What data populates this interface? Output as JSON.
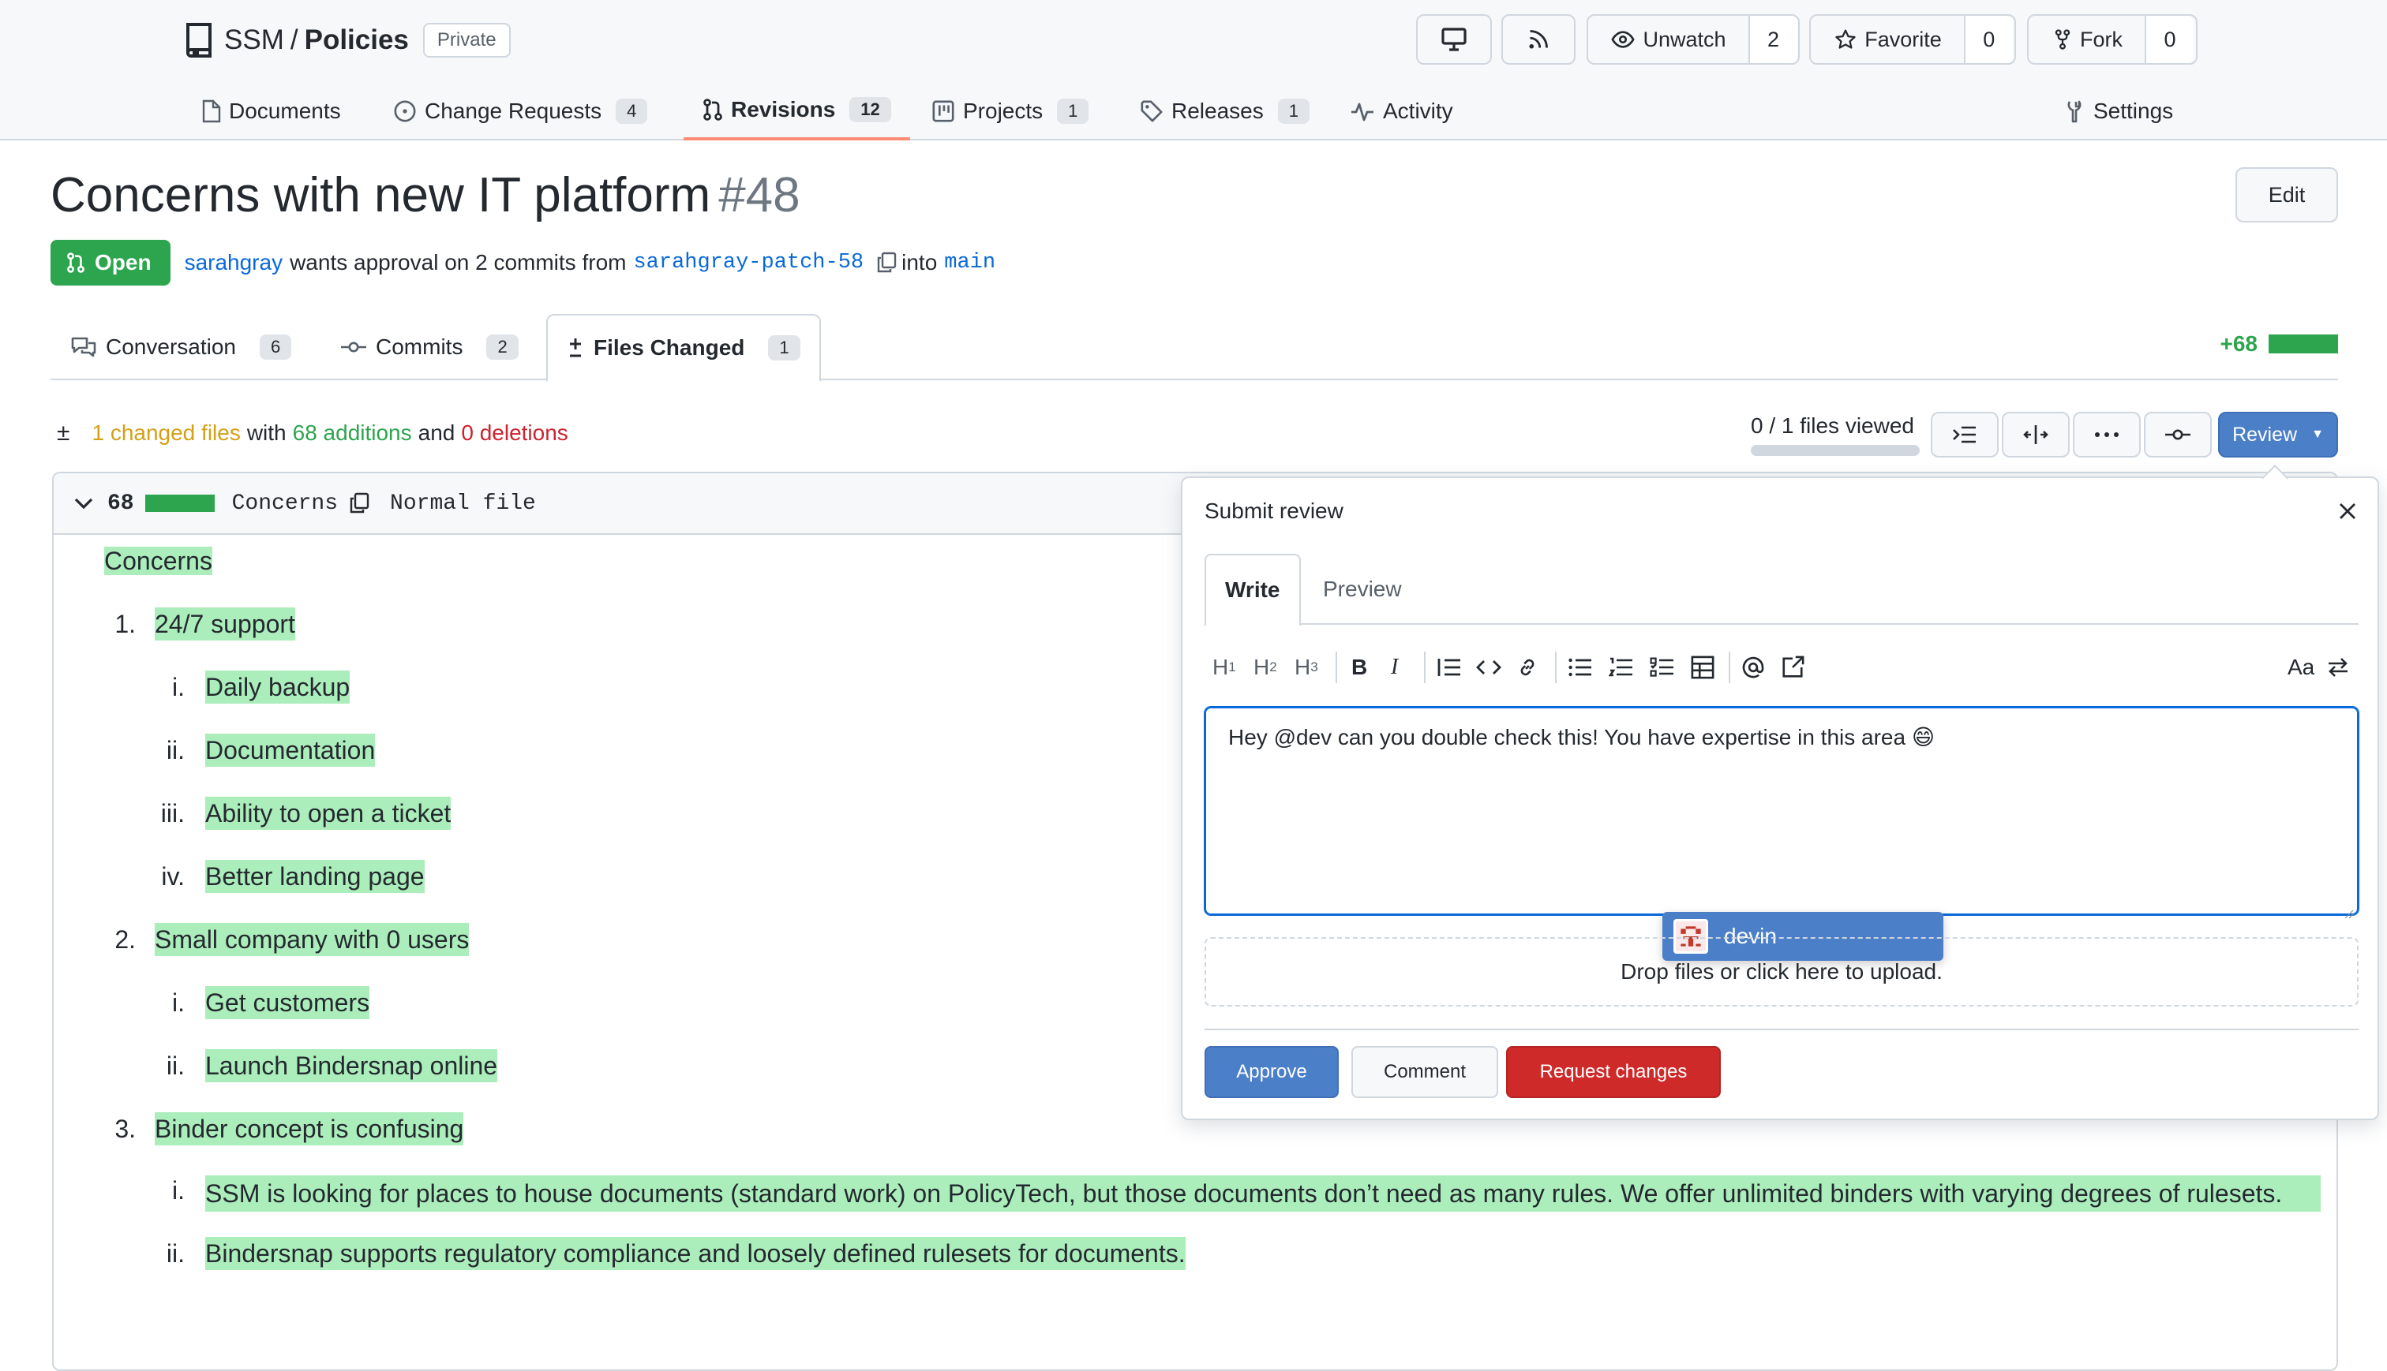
{
  "repo": {
    "owner": "SSM",
    "separator": "/",
    "name": "Policies",
    "visibility": "Private"
  },
  "header_actions": {
    "unwatch_label": "Unwatch",
    "unwatch_count": "2",
    "favorite_label": "Favorite",
    "favorite_count": "0",
    "fork_label": "Fork",
    "fork_count": "0"
  },
  "repo_nav": [
    {
      "label": "Documents",
      "count": ""
    },
    {
      "label": "Change Requests",
      "count": "4"
    },
    {
      "label": "Revisions",
      "count": "12",
      "active": true
    },
    {
      "label": "Projects",
      "count": "1"
    },
    {
      "label": "Releases",
      "count": "1"
    },
    {
      "label": "Activity",
      "count": ""
    },
    {
      "label": "Settings",
      "count": ""
    }
  ],
  "pr": {
    "title": "Concerns with new IT platform",
    "number": "#48",
    "edit_label": "Edit",
    "status": "Open",
    "author": "sarahgray",
    "meta_text": "wants approval on 2 commits from",
    "source_branch": "sarahgray-patch-58",
    "into_text": "into",
    "target_branch": "main"
  },
  "pr_tabs": [
    {
      "label": "Conversation",
      "count": "6"
    },
    {
      "label": "Commits",
      "count": "2"
    },
    {
      "label": "Files Changed",
      "count": "1",
      "active": true
    }
  ],
  "diffstat": {
    "additions_total": "+68"
  },
  "files_summary": {
    "changed": "1 changed files",
    "with_text": "with",
    "additions": "68 additions",
    "and_text": "and",
    "deletions": "0 deletions",
    "viewed": "0 / 1 files viewed",
    "viewed_fraction": 0
  },
  "review_button_label": "Review",
  "file": {
    "additions": "68",
    "name": "Concerns",
    "type": "Normal file"
  },
  "document": {
    "heading": "Concerns",
    "items": [
      {
        "marker": "1.",
        "text": "24/7 support"
      },
      {
        "marker": "i.",
        "text": "Daily backup"
      },
      {
        "marker": "ii.",
        "text": "Documentation"
      },
      {
        "marker": "iii.",
        "text": "Ability to open a ticket"
      },
      {
        "marker": "iv.",
        "text": "Better landing page"
      },
      {
        "marker": "2.",
        "text": "Small company with 0 users"
      },
      {
        "marker": "i.",
        "text": "Get customers"
      },
      {
        "marker": "ii.",
        "text": "Launch Bindersnap online"
      },
      {
        "marker": "3.",
        "text": "Binder concept is confusing"
      },
      {
        "marker": "i.",
        "text": "SSM is looking for places to house documents (standard work) on PolicyTech, but those documents don’t need as many rules. We offer unlimited binders with varying degrees of rulesets."
      },
      {
        "marker": "ii.",
        "text": "Bindersnap supports regulatory compliance and loosely defined rulesets for documents."
      }
    ]
  },
  "review_popover": {
    "title": "Submit review",
    "tab_write": "Write",
    "tab_preview": "Preview",
    "toolbar": {
      "h1": "H",
      "h2": "H",
      "h3": "H",
      "sub1": "1",
      "sub2": "2",
      "sub3": "3",
      "bold": "B",
      "italic": "I",
      "text_size": "Aa"
    },
    "comment_text": "Hey @dev can you double check this! You have expertise in this area",
    "comment_emoji": "😄",
    "mention_suggestion": "devin",
    "dropzone_text": "Drop files or click here to upload.",
    "approve_label": "Approve",
    "comment_label": "Comment",
    "request_changes_label": "Request changes"
  },
  "colors": {
    "accent_blue": "#4b7fc8",
    "open_green": "#2da44e",
    "added_highlight": "#aceebb",
    "danger_red": "#cf2a2a"
  }
}
